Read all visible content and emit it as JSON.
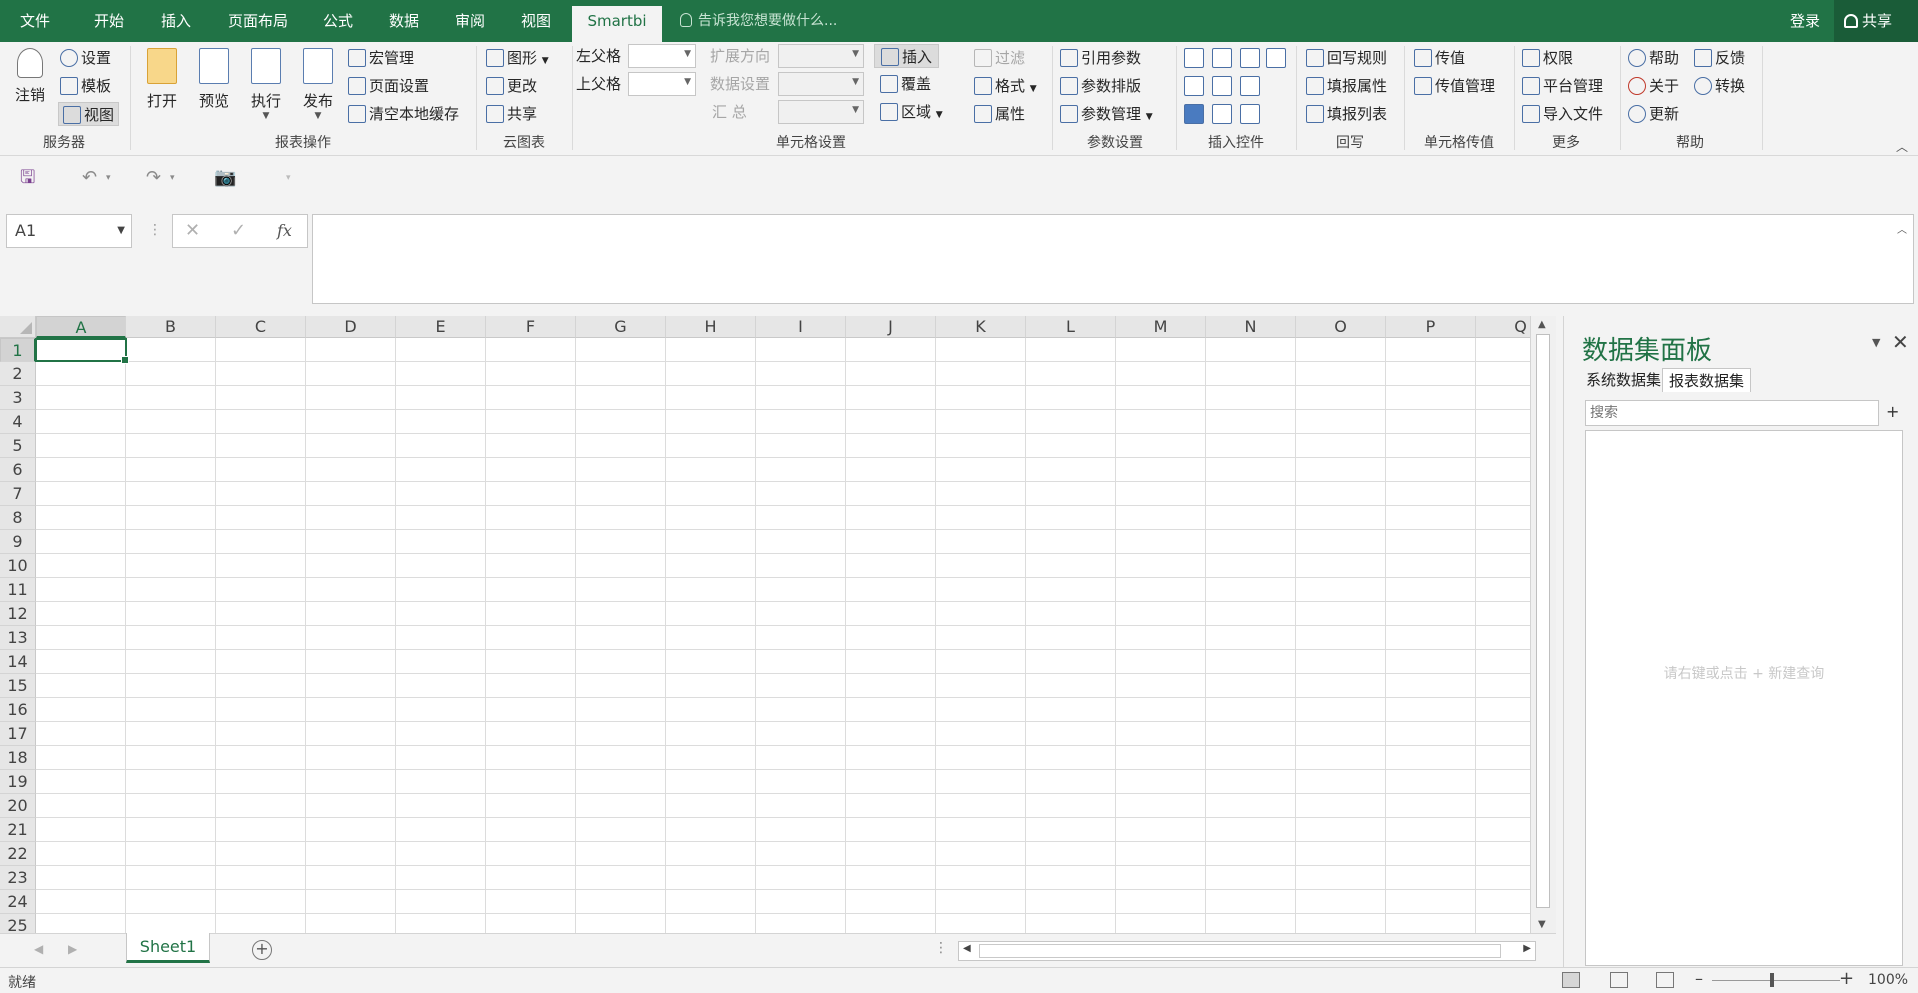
{
  "menu": {
    "tabs": [
      "文件",
      "开始",
      "插入",
      "页面布局",
      "公式",
      "数据",
      "审阅",
      "视图",
      "Smartbi"
    ],
    "active_tab": "Smartbi",
    "tell_me": "告诉我您想要做什么...",
    "login": "登录",
    "share": "共享"
  },
  "ribbon": {
    "server": {
      "label": "服务器",
      "logout": "注销",
      "settings": "设置",
      "template": "模板",
      "view": "视图"
    },
    "report_ops": {
      "label": "报表操作",
      "open": "打开",
      "preview": "预览",
      "execute": "执行",
      "publish": "发布",
      "macro": "宏管理",
      "page_setup": "页面设置",
      "clear_cache": "清空本地缓存"
    },
    "cloud_chart": {
      "label": "云图表",
      "chart": "图形",
      "change": "更改",
      "share": "共享"
    },
    "cell_settings": {
      "label": "单元格设置",
      "left_parent": "左父格",
      "upper_parent": "上父格",
      "expand_dir": "扩展方向",
      "data_setting": "数据设置",
      "summary": "汇 总",
      "insert": "插入",
      "cover": "覆盖",
      "area": "区域",
      "filter": "过滤",
      "format": "格式",
      "property": "属性"
    },
    "param_settings": {
      "label": "参数设置",
      "ref_param": "引用参数",
      "param_layout": "参数排版",
      "param_mgmt": "参数管理"
    },
    "insert_ctrl": {
      "label": "插入控件"
    },
    "writeback": {
      "label": "回写",
      "rules": "回写规则",
      "fill_props": "填报属性",
      "fill_list": "填报列表"
    },
    "cell_pass": {
      "label": "单元格传值",
      "pass": "传值",
      "pass_mgmt": "传值管理"
    },
    "more": {
      "label": "更多",
      "perm": "权限",
      "platform": "平台管理",
      "import": "导入文件"
    },
    "help": {
      "label": "帮助",
      "help": "帮助",
      "about": "关于",
      "update": "更新",
      "feedback": "反馈",
      "convert": "转换"
    }
  },
  "formula_bar": {
    "name_box": "A1",
    "fx": "fx",
    "value": ""
  },
  "grid": {
    "columns": [
      "A",
      "B",
      "C",
      "D",
      "E",
      "F",
      "G",
      "H",
      "I",
      "J",
      "K",
      "L",
      "M",
      "N",
      "O",
      "P",
      "Q"
    ],
    "rows": [
      "1",
      "2",
      "3",
      "4",
      "5",
      "6",
      "7",
      "8",
      "9",
      "10",
      "11",
      "12",
      "13",
      "14",
      "15",
      "16",
      "17",
      "18",
      "19",
      "20",
      "21",
      "22",
      "23",
      "24",
      "25"
    ],
    "active_cell": "A1"
  },
  "sheets": [
    "Sheet1"
  ],
  "panel": {
    "title": "数据集面板",
    "tabs": [
      "系统数据集",
      "报表数据集"
    ],
    "active_tab": "报表数据集",
    "search_placeholder": "搜索",
    "add": "+",
    "hint": "请右键或点击 + 新建查询"
  },
  "status": {
    "text": "就绪",
    "zoom": "100%"
  },
  "colors": {
    "accent": "#217346",
    "ribbon_bg": "#f3f3f3"
  }
}
